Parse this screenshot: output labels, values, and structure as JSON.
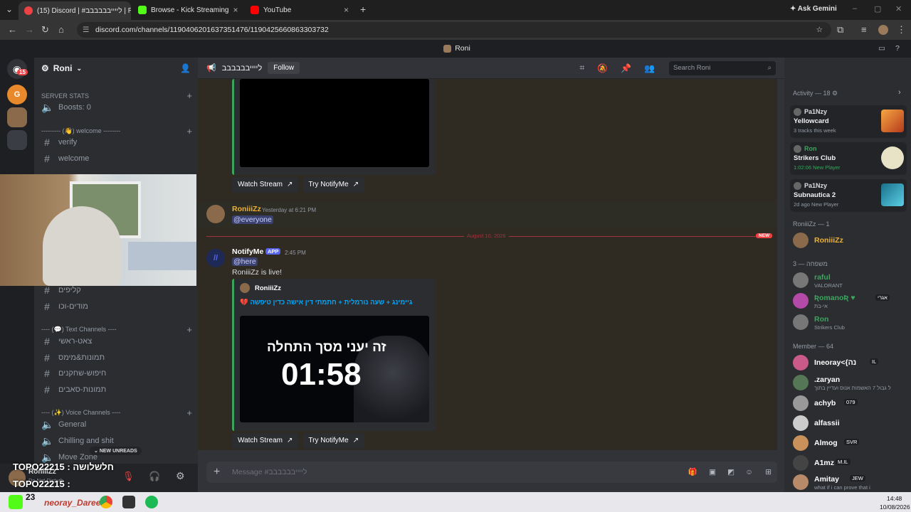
{
  "browser": {
    "tabs": [
      {
        "label": "(15) Discord | #לייייבבבבבב | Ro"
      },
      {
        "label": "Browse - Kick Streaming"
      },
      {
        "label": "YouTube"
      }
    ],
    "ask_gemini": "Ask Gemini",
    "url": "discord.com/channels/1190406201637351476/1190425660863303732"
  },
  "window_title": "Roni",
  "guilds": {
    "badge": "15"
  },
  "server": {
    "name": "Roni",
    "server_stats_cat": "SERVER STATS",
    "boosts": "Boosts: 0",
    "welcome_cat": "--------- (👋) welcome --------",
    "channels": [
      {
        "label": "verify"
      },
      {
        "label": "welcome"
      },
      {
        "label": "קליפים"
      },
      {
        "label": "מודים-וכו"
      }
    ],
    "text_cat": "---- (💬) Text Channels ----",
    "text_channels": [
      {
        "label": "צאט-ראשי"
      },
      {
        "label": "תמונות&מימס"
      },
      {
        "label": "חיפוש-שחקנים"
      },
      {
        "label": "תמונות-סאבים"
      }
    ],
    "voice_cat": "---- (✨) Voice Channels ----",
    "voice_channels": [
      {
        "label": "General"
      },
      {
        "label": "Chilling and shit"
      },
      {
        "label": "Move Zone"
      }
    ],
    "new_unreads": "NEW UNREADS"
  },
  "user_panel": {
    "name": "RoniiiZz",
    "status": "Do Not Disturb",
    "overlay1": "TOPO22215 : חלשלושה",
    "overlay2": "TOPO22215 :"
  },
  "channel": {
    "name": "לייייבבבבבב",
    "follow": "Follow",
    "search_placeholder": "Search Roni",
    "composer_placeholder": "Message #לייייבבבבבב"
  },
  "messages": {
    "watch_stream": "Watch Stream",
    "try_notifyme": "Try NotifyMe",
    "m1_author": "RoniiiZz",
    "m1_time": "Yesterday at 6:21 PM",
    "m1_text": "@everyone",
    "divider_date": "August 10, 2026",
    "new_label": "NEW",
    "m2_author": "NotifyMe",
    "m2_app": "APP",
    "m2_time": "2:45 PM",
    "m2_mention": "@here",
    "m2_text": "RoniiiZz is live!",
    "embed_author": "RoniiiZz",
    "embed_title": "💔 גיימינג + שעה נורמלית + חתמתי דין אישה כדין טיפשה",
    "thumb_line1": "זה יעני מסך התחלה",
    "thumb_timer": "01:58"
  },
  "members": {
    "activity_hdr": "Activity — 18",
    "activities": [
      {
        "name": "Pa1Nzy",
        "game": "Yellowcard",
        "sub": "3 tracks this week"
      },
      {
        "name": "Ron",
        "game": "Strikers Club",
        "sub": "1:02:06  New Player"
      },
      {
        "name": "Pa1Nzy",
        "game": "Subnautica 2",
        "sub": "2d ago  New Player"
      }
    ],
    "owner_hdr": "RoniiiZz — 1",
    "owner": "RoniiiZz",
    "family_hdr": "משפחה — 3",
    "family": [
      {
        "name": "raful",
        "sub": "VALORANT"
      },
      {
        "name": "ƦomanoƦ ♥",
        "sub": "אי-בת",
        "tag": "אגרי"
      },
      {
        "name": "Ron",
        "sub": "Strikers Club"
      }
    ],
    "member_hdr": "Member — 64",
    "list": [
      {
        "name": "Ineoray<{נה",
        "tag": "IL",
        "sub": ""
      },
      {
        "name": ".zaryan",
        "tag": "",
        "sub": "ל גבול 7 האשמות אנוס ועדיין בתוך"
      },
      {
        "name": "achyb",
        "tag": "079",
        "sub": ""
      },
      {
        "name": "alfassii",
        "tag": "",
        "sub": ""
      },
      {
        "name": "Almog",
        "tag": "SVR",
        "sub": ""
      },
      {
        "name": "A1mz",
        "tag": "M.IL",
        "sub": ""
      },
      {
        "name": "Amitay",
        "tag": "JEW",
        "sub": "what if i can prove that i"
      }
    ]
  },
  "taskbar": {
    "time": "14:48",
    "date": "10/08/2026",
    "count": "23",
    "stream_text": "neoray_Dareeni"
  }
}
